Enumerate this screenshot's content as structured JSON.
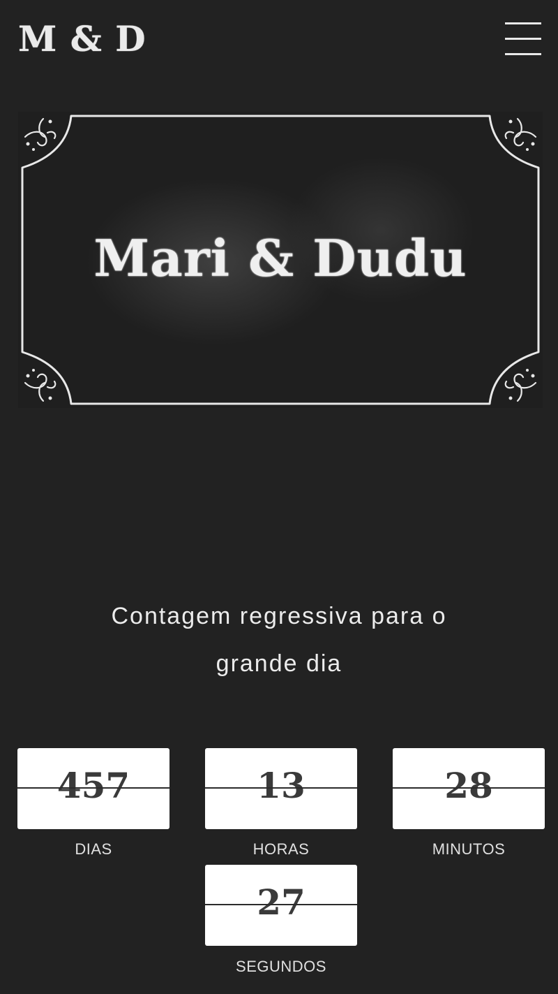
{
  "header": {
    "logo": "M & D",
    "menu_icon": "hamburger-menu-icon"
  },
  "hero": {
    "title": "Mari & Dudu",
    "corner_icon": "flourish-ornament-icon"
  },
  "countdown": {
    "heading": "Contagem regressiva para o grande dia",
    "units": [
      {
        "value": "457",
        "label": "DIAS"
      },
      {
        "value": "13",
        "label": "HORAS"
      },
      {
        "value": "28",
        "label": "MINUTOS"
      },
      {
        "value": "27",
        "label": "SEGUNDOS"
      }
    ]
  },
  "colors": {
    "background": "#222222",
    "chalk": "#efefef",
    "tile": "#ffffff",
    "tile_text": "#3a3a3a"
  }
}
